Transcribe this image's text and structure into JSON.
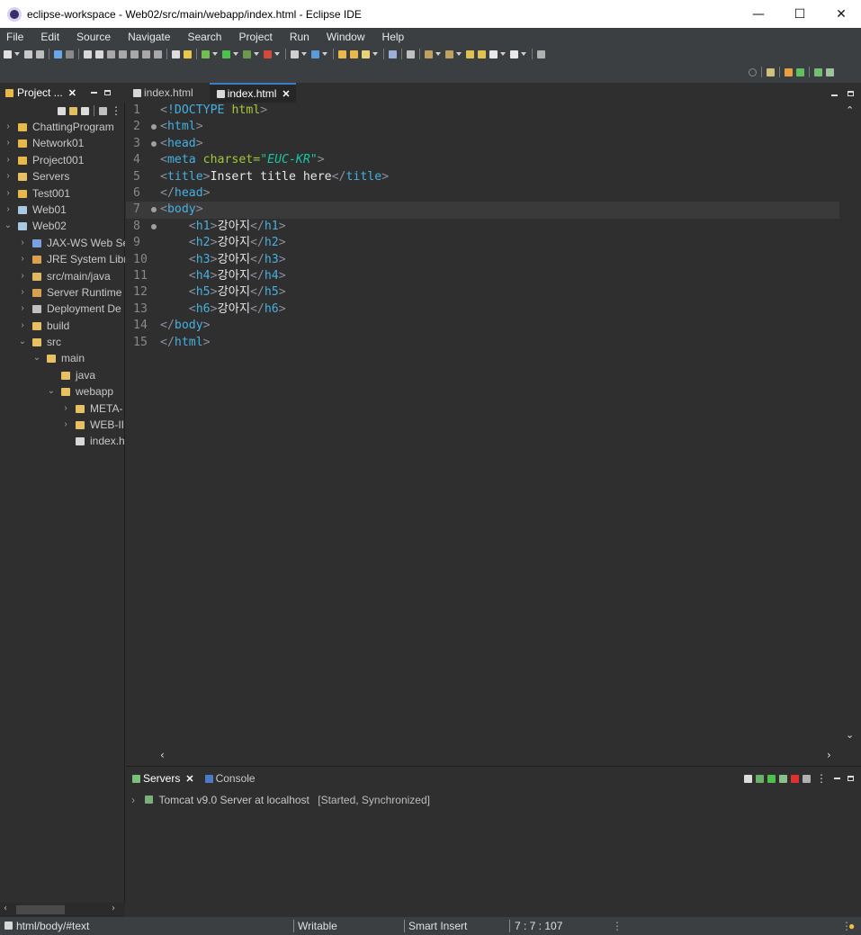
{
  "window": {
    "title": "eclipse-workspace - Web02/src/main/webapp/index.html - Eclipse IDE",
    "controls": {
      "minimize": "—",
      "maximize": "☐",
      "close": "✕"
    }
  },
  "menu": [
    "File",
    "Edit",
    "Source",
    "Navigate",
    "Search",
    "Project",
    "Run",
    "Window",
    "Help"
  ],
  "explorer": {
    "tab_label": "Project ...",
    "tree": [
      {
        "label": "ChattingProgram",
        "depth": 0,
        "twisty": "›",
        "icon": "project-icon"
      },
      {
        "label": "Network01",
        "depth": 0,
        "twisty": "›",
        "icon": "project-icon"
      },
      {
        "label": "Project001",
        "depth": 0,
        "twisty": "›",
        "icon": "project-icon"
      },
      {
        "label": "Servers",
        "depth": 0,
        "twisty": "›",
        "icon": "folder-icon"
      },
      {
        "label": "Test001",
        "depth": 0,
        "twisty": "›",
        "icon": "project-icon"
      },
      {
        "label": "Web01",
        "depth": 0,
        "twisty": "›",
        "icon": "web-project-icon"
      },
      {
        "label": "Web02",
        "depth": 0,
        "twisty": "⌄",
        "icon": "web-project-icon"
      },
      {
        "label": "JAX-WS Web Se",
        "depth": 1,
        "twisty": "›",
        "icon": "jaxws-icon"
      },
      {
        "label": "JRE System Libr",
        "depth": 1,
        "twisty": "›",
        "icon": "library-icon"
      },
      {
        "label": "src/main/java",
        "depth": 1,
        "twisty": "›",
        "icon": "source-folder-icon"
      },
      {
        "label": "Server Runtime",
        "depth": 1,
        "twisty": "›",
        "icon": "library-icon"
      },
      {
        "label": "Deployment De",
        "depth": 1,
        "twisty": "›",
        "icon": "deployment-icon"
      },
      {
        "label": "build",
        "depth": 1,
        "twisty": "›",
        "icon": "folder-icon"
      },
      {
        "label": "src",
        "depth": 1,
        "twisty": "⌄",
        "icon": "folder-icon"
      },
      {
        "label": "main",
        "depth": 2,
        "twisty": "⌄",
        "icon": "folder-icon"
      },
      {
        "label": "java",
        "depth": 3,
        "twisty": "",
        "icon": "folder-icon"
      },
      {
        "label": "webapp",
        "depth": 3,
        "twisty": "⌄",
        "icon": "folder-icon"
      },
      {
        "label": "META-",
        "depth": 4,
        "twisty": "›",
        "icon": "folder-icon"
      },
      {
        "label": "WEB-II",
        "depth": 4,
        "twisty": "›",
        "icon": "folder-icon"
      },
      {
        "label": "index.h",
        "depth": 4,
        "twisty": "",
        "icon": "file-icon"
      }
    ]
  },
  "editor": {
    "tabs": [
      {
        "label": "index.html",
        "active": false
      },
      {
        "label": "index.html",
        "active": true
      }
    ],
    "current_line": 7,
    "lines": [
      {
        "n": "1",
        "fold": false,
        "tokens": [
          [
            "br",
            "<"
          ],
          [
            "dt",
            "!DOCTYPE"
          ],
          [
            "tx",
            " "
          ],
          [
            "at",
            "html"
          ],
          [
            "br",
            ">"
          ]
        ]
      },
      {
        "n": "2",
        "fold": true,
        "tokens": [
          [
            "br",
            "<"
          ],
          [
            "tg",
            "html"
          ],
          [
            "br",
            ">"
          ]
        ]
      },
      {
        "n": "3",
        "fold": true,
        "tokens": [
          [
            "br",
            "<"
          ],
          [
            "tg",
            "head"
          ],
          [
            "br",
            ">"
          ]
        ]
      },
      {
        "n": "4",
        "fold": false,
        "tokens": [
          [
            "br",
            "<"
          ],
          [
            "tg",
            "meta"
          ],
          [
            "tx",
            " "
          ],
          [
            "at",
            "charset="
          ],
          [
            "av",
            "\"EUC-KR\""
          ],
          [
            "br",
            ">"
          ]
        ]
      },
      {
        "n": "5",
        "fold": false,
        "tokens": [
          [
            "br",
            "<"
          ],
          [
            "tg",
            "title"
          ],
          [
            "br",
            ">"
          ],
          [
            "tx",
            "Insert title here"
          ],
          [
            "br",
            "</"
          ],
          [
            "tg",
            "title"
          ],
          [
            "br",
            ">"
          ]
        ]
      },
      {
        "n": "6",
        "fold": false,
        "tokens": [
          [
            "br",
            "</"
          ],
          [
            "tg",
            "head"
          ],
          [
            "br",
            ">"
          ]
        ]
      },
      {
        "n": "7",
        "fold": true,
        "tokens": [
          [
            "br",
            "<"
          ],
          [
            "tg",
            "body"
          ],
          [
            "br",
            ">"
          ]
        ]
      },
      {
        "n": "8",
        "fold": true,
        "tokens": [
          [
            "tx",
            "    "
          ],
          [
            "br",
            "<"
          ],
          [
            "tg",
            "h1"
          ],
          [
            "br",
            ">"
          ],
          [
            "tx",
            "강아지"
          ],
          [
            "br",
            "</"
          ],
          [
            "tg",
            "h1"
          ],
          [
            "br",
            ">"
          ]
        ]
      },
      {
        "n": "9",
        "fold": false,
        "tokens": [
          [
            "tx",
            "    "
          ],
          [
            "br",
            "<"
          ],
          [
            "tg",
            "h2"
          ],
          [
            "br",
            ">"
          ],
          [
            "tx",
            "강아지"
          ],
          [
            "br",
            "</"
          ],
          [
            "tg",
            "h2"
          ],
          [
            "br",
            ">"
          ]
        ]
      },
      {
        "n": "10",
        "fold": false,
        "tokens": [
          [
            "tx",
            "    "
          ],
          [
            "br",
            "<"
          ],
          [
            "tg",
            "h3"
          ],
          [
            "br",
            ">"
          ],
          [
            "tx",
            "강아지"
          ],
          [
            "br",
            "</"
          ],
          [
            "tg",
            "h3"
          ],
          [
            "br",
            ">"
          ]
        ]
      },
      {
        "n": "11",
        "fold": false,
        "tokens": [
          [
            "tx",
            "    "
          ],
          [
            "br",
            "<"
          ],
          [
            "tg",
            "h4"
          ],
          [
            "br",
            ">"
          ],
          [
            "tx",
            "강아지"
          ],
          [
            "br",
            "</"
          ],
          [
            "tg",
            "h4"
          ],
          [
            "br",
            ">"
          ]
        ]
      },
      {
        "n": "12",
        "fold": false,
        "tokens": [
          [
            "tx",
            "    "
          ],
          [
            "br",
            "<"
          ],
          [
            "tg",
            "h5"
          ],
          [
            "br",
            ">"
          ],
          [
            "tx",
            "강아지"
          ],
          [
            "br",
            "</"
          ],
          [
            "tg",
            "h5"
          ],
          [
            "br",
            ">"
          ]
        ]
      },
      {
        "n": "13",
        "fold": false,
        "tokens": [
          [
            "tx",
            "    "
          ],
          [
            "br",
            "<"
          ],
          [
            "tg",
            "h6"
          ],
          [
            "br",
            ">"
          ],
          [
            "tx",
            "강아지"
          ],
          [
            "br",
            "</"
          ],
          [
            "tg",
            "h6"
          ],
          [
            "br",
            ">"
          ]
        ]
      },
      {
        "n": "14",
        "fold": false,
        "tokens": [
          [
            "br",
            "</"
          ],
          [
            "tg",
            "body"
          ],
          [
            "br",
            ">"
          ]
        ]
      },
      {
        "n": "15",
        "fold": false,
        "tokens": [
          [
            "br",
            "</"
          ],
          [
            "tg",
            "html"
          ],
          [
            "br",
            ">"
          ]
        ]
      }
    ]
  },
  "servers": {
    "tabs": [
      {
        "label": "Servers",
        "closable": true
      },
      {
        "label": "Console",
        "closable": false
      }
    ],
    "entries": [
      {
        "name": "Tomcat v9.0 Server at localhost",
        "state": "[Started, Synchronized]"
      }
    ]
  },
  "status": {
    "path": "html/body/#text",
    "writable": "Writable",
    "insert_mode": "Smart Insert",
    "position": "7 : 7 : 107"
  },
  "colors": {
    "tag": "#45b0e0",
    "attribute": "#a4c639",
    "attribute_value": "#17c6a3",
    "bracket": "#8a8f9c",
    "background": "#2f2f2f"
  }
}
